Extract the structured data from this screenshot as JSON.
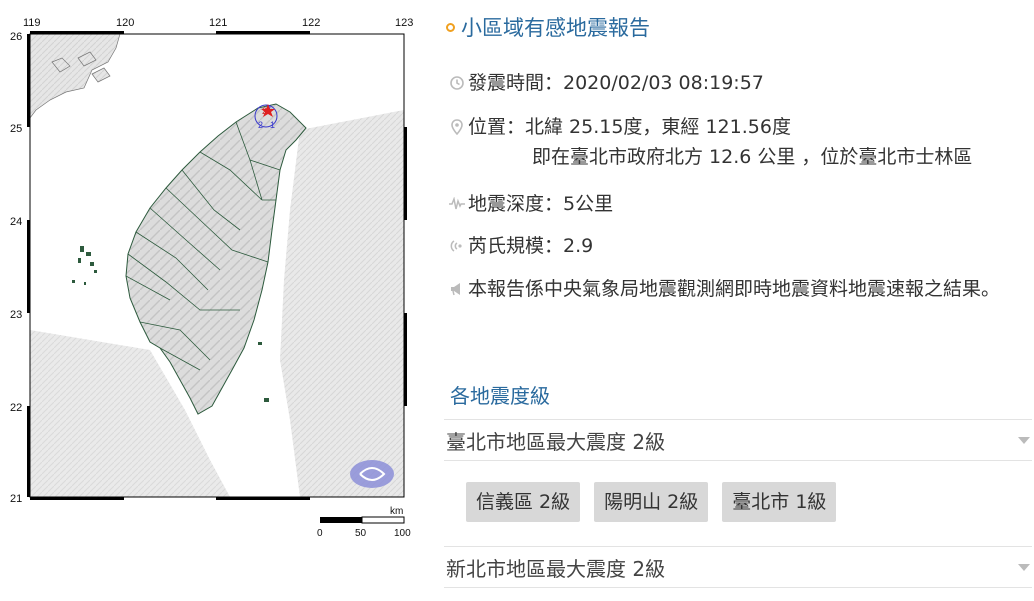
{
  "map": {
    "lon_ticks": [
      "119",
      "120",
      "121",
      "122",
      "123"
    ],
    "lat_ticks": [
      "26",
      "25",
      "24",
      "23",
      "22",
      "21"
    ],
    "marker_label": "2",
    "nearby_intensity_labels": [
      "2",
      "1",
      "2"
    ],
    "scale": {
      "unit": "km",
      "ticks": [
        "0",
        "50",
        "100"
      ]
    },
    "colors": {
      "land": "#e4e4e4",
      "sea": "#ffffff",
      "marker": "#e02020",
      "border": "#2d5a3d",
      "logo": "#8c8fd8"
    }
  },
  "report": {
    "title": "小區域有感地震報告",
    "time": {
      "label": "發震時間：2020/02/03 08:19:57",
      "icon": "clock-icon"
    },
    "location": {
      "line1": "位置：北緯 25.15度，東經 121.56度",
      "line2": "即在臺北市政府北方 12.6 公里 ，位於臺北市士林區",
      "icon": "map-pin-icon"
    },
    "depth": {
      "label": "地震深度：5公里",
      "icon": "seismograph-icon"
    },
    "magnitude": {
      "label": "芮氏規模：2.9",
      "icon": "wave-icon"
    },
    "note": {
      "text": "本報告係中央氣象局地震觀測網即時地震資料地震速報之結果。",
      "icon": "megaphone-icon"
    },
    "intensity_section": {
      "title": "各地震度級",
      "regions": [
        {
          "label": "臺北市地區最大震度 2級",
          "stations": [
            "信義區 2級",
            "陽明山 2級",
            "臺北市 1級"
          ]
        },
        {
          "label": "新北市地區最大震度 2級",
          "stations": []
        }
      ]
    },
    "accent_color": "#2a6a9e"
  }
}
